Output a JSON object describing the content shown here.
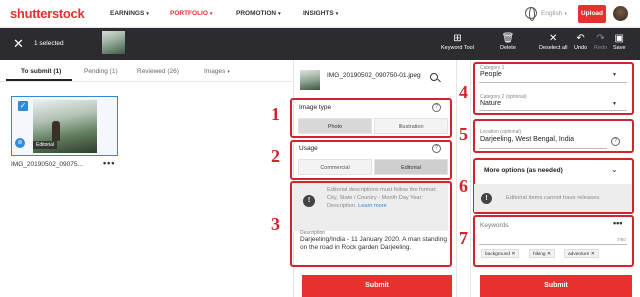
{
  "nav": {
    "logo": "shutterstock",
    "links": [
      {
        "label": "EARNINGS",
        "active": false
      },
      {
        "label": "PORTFOLIO",
        "active": true
      },
      {
        "label": "PROMOTION",
        "active": false
      },
      {
        "label": "INSIGHTS",
        "active": false
      }
    ],
    "language": "English",
    "upload_label": "Upload",
    "accent_color": "#e8302f"
  },
  "toolbar": {
    "selected_text": "1 selected",
    "buttons": {
      "keyword_tool": "Keyword Tool",
      "delete": "Delete",
      "deselect_all": "Deselect all",
      "undo": "Undo",
      "redo": "Redo",
      "save": "Save"
    }
  },
  "tabs": {
    "to_submit": "To submit (1)",
    "pending": "Pending (1)",
    "reviewed": "Reviewed (26)",
    "filter": "Images"
  },
  "asset": {
    "filename_short": "IMG_20190502_09075...",
    "filename_full": "IMG_20190502_090750-01.jpeg",
    "editorial_badge": "Editorial"
  },
  "image_type": {
    "title": "Image type",
    "options": [
      "Photo",
      "Illustration"
    ],
    "selected": "Photo"
  },
  "usage": {
    "title": "Usage",
    "options": [
      "Commercial",
      "Editorial"
    ],
    "selected": "Editorial"
  },
  "editorial_note": {
    "text": "Editorial descriptions must follow the format: City, State / Country - Month Day Year: Description.",
    "link": "Learn more"
  },
  "description": {
    "label": "Description",
    "value": "Darjeeling/India - 11 January 2020. A man standing on the road in Rock garden Darjeeling."
  },
  "categories": {
    "cat1_label": "Category 1",
    "cat1_value": "People",
    "cat2_label": "Category 2 (optional)",
    "cat2_value": "Nature"
  },
  "location": {
    "label": "Location (optional)",
    "value": "Darjeeling, West Bengal, India"
  },
  "more_options": {
    "title": "More options (as needed)",
    "note": "Editorial items cannot have releases."
  },
  "keywords": {
    "label": "Keywords",
    "count": "7/50",
    "items": [
      "background",
      "hiking",
      "adventure"
    ]
  },
  "submit_label": "Submit",
  "annotations": [
    "1",
    "2",
    "3",
    "4",
    "5",
    "6",
    "7"
  ]
}
